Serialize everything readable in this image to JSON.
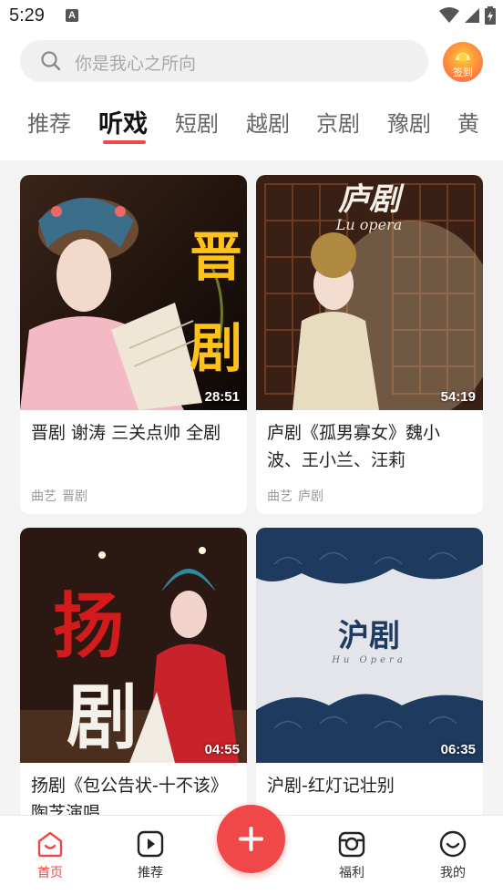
{
  "status_bar": {
    "time": "5:29",
    "notification_badge": "A"
  },
  "search": {
    "placeholder": "你是我心之所向"
  },
  "checkin": {
    "label": "签到"
  },
  "tabs": [
    {
      "label": "推荐",
      "active": false
    },
    {
      "label": "听戏",
      "active": true
    },
    {
      "label": "短剧",
      "active": false
    },
    {
      "label": "越剧",
      "active": false
    },
    {
      "label": "京剧",
      "active": false
    },
    {
      "label": "豫剧",
      "active": false
    },
    {
      "label": "黄",
      "active": false
    }
  ],
  "cards": [
    {
      "title": "晋剧 谢涛 三关点帅 全剧",
      "duration": "28:51",
      "tags": [
        "曲艺",
        "晋剧"
      ],
      "art_text": "晋剧"
    },
    {
      "title": "庐剧《孤男寡女》魏小波、王小兰、汪莉",
      "duration": "54:19",
      "tags": [
        "曲艺",
        "庐剧"
      ],
      "art_text": "庐剧",
      "art_subtext": "Lu opera"
    },
    {
      "title": "扬剧《包公告状-十不该》陶芝演唱",
      "duration": "04:55",
      "tags": [],
      "art_text": "扬剧"
    },
    {
      "title": "沪剧-红灯记壮别",
      "duration": "06:35",
      "tags": [],
      "art_text": "沪剧",
      "art_subtext": "Hu Opera"
    }
  ],
  "bottom_nav": [
    {
      "label": "首页",
      "icon": "home-icon",
      "active": true
    },
    {
      "label": "推荐",
      "icon": "play-icon",
      "active": false
    },
    {
      "label": "福利",
      "icon": "gift-icon",
      "active": false
    },
    {
      "label": "我的",
      "icon": "smile-icon",
      "active": false
    }
  ],
  "colors": {
    "accent": "#f04848",
    "background": "#f3f3f3"
  }
}
